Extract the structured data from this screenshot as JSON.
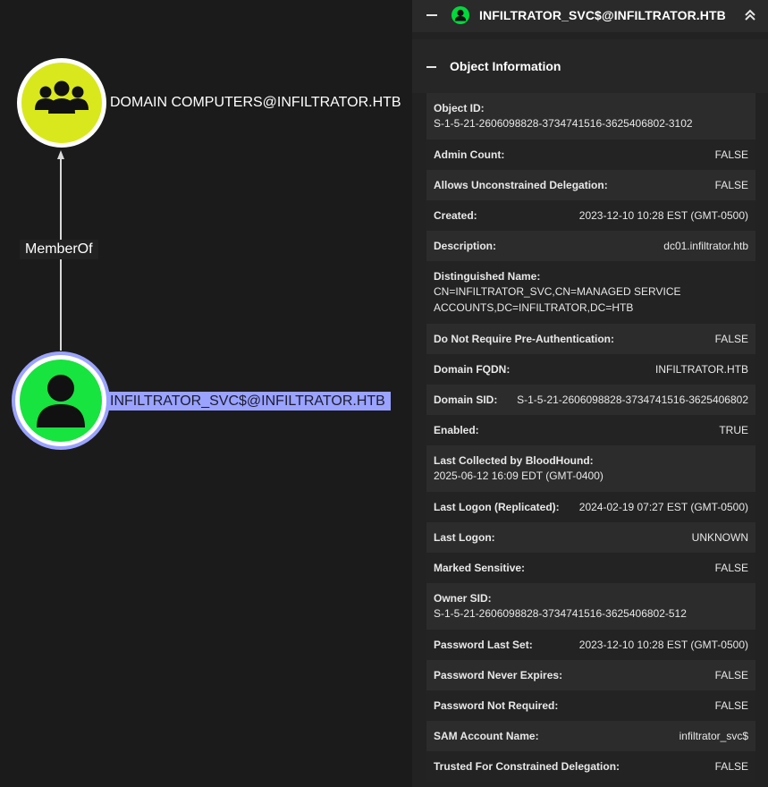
{
  "graph": {
    "target_node": {
      "label": "DOMAIN COMPUTERS@INFILTRATOR.HTB",
      "icon": "group-icon",
      "color": "#d9e81c"
    },
    "source_node": {
      "label": "INFILTRATOR_SVC$@INFILTRATOR.HTB",
      "icon": "user-icon",
      "color": "#17e43f",
      "selected": true
    },
    "edge": {
      "label": "MemberOf"
    }
  },
  "panel": {
    "header_title": "INFILTRATOR_SVC$@INFILTRATOR.HTB",
    "section_title": "Object Information",
    "properties": [
      {
        "key": "Object ID:",
        "value": "S-1-5-21-2606098828-3734741516-3625406802-3102",
        "layout": "stacked"
      },
      {
        "key": "Admin Count:",
        "value": "FALSE"
      },
      {
        "key": "Allows Unconstrained Delegation:",
        "value": "FALSE"
      },
      {
        "key": "Created:",
        "value": "2023-12-10 10:28 EST (GMT-0500)"
      },
      {
        "key": "Description:",
        "value": "dc01.infiltrator.htb"
      },
      {
        "key": "Distinguished Name:",
        "value": "CN=INFILTRATOR_SVC,CN=MANAGED SERVICE ACCOUNTS,DC=INFILTRATOR,DC=HTB",
        "layout": "stacked"
      },
      {
        "key": "Do Not Require Pre-Authentication:",
        "value": "FALSE"
      },
      {
        "key": "Domain FQDN:",
        "value": "INFILTRATOR.HTB"
      },
      {
        "key": "Domain SID:",
        "value": "S-1-5-21-2606098828-3734741516-3625406802"
      },
      {
        "key": "Enabled:",
        "value": "TRUE"
      },
      {
        "key": "Last Collected by BloodHound:",
        "value": "2025-06-12 16:09 EDT (GMT-0400)",
        "layout": "stacked"
      },
      {
        "key": "Last Logon (Replicated):",
        "value": "2024-02-19 07:27 EST (GMT-0500)"
      },
      {
        "key": "Last Logon:",
        "value": "UNKNOWN"
      },
      {
        "key": "Marked Sensitive:",
        "value": "FALSE"
      },
      {
        "key": "Owner SID:",
        "value": "S-1-5-21-2606098828-3734741516-3625406802-512",
        "layout": "stacked"
      },
      {
        "key": "Password Last Set:",
        "value": "2023-12-10 10:28 EST (GMT-0500)"
      },
      {
        "key": "Password Never Expires:",
        "value": "FALSE"
      },
      {
        "key": "Password Not Required:",
        "value": "FALSE"
      },
      {
        "key": "SAM Account Name:",
        "value": "infiltrator_svc$"
      },
      {
        "key": "Trusted For Constrained Delegation:",
        "value": "FALSE"
      }
    ]
  }
}
